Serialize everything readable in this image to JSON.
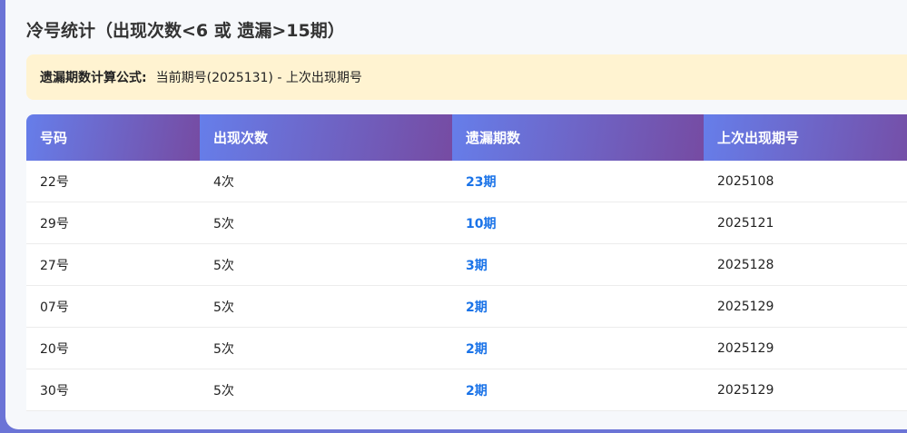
{
  "title": "冷号统计（出现次数<6 或 遗漏>15期）",
  "formula": {
    "label": "遗漏期数计算公式:",
    "text": "当前期号(2025131) - 上次出现期号"
  },
  "table": {
    "headers": [
      "号码",
      "出现次数",
      "遗漏期数",
      "上次出现期号"
    ],
    "rows": [
      [
        "22号",
        "4次",
        "23期",
        "2025108"
      ],
      [
        "29号",
        "5次",
        "10期",
        "2025121"
      ],
      [
        "27号",
        "5次",
        "3期",
        "2025128"
      ],
      [
        "07号",
        "5次",
        "2期",
        "2025129"
      ],
      [
        "20号",
        "5次",
        "2期",
        "2025129"
      ],
      [
        "30号",
        "5次",
        "2期",
        "2025129"
      ]
    ]
  },
  "colors": {
    "header_gradient_start": "#667eea",
    "header_gradient_end": "#764ba2",
    "miss_text": "#1a73e8",
    "formula_bg": "#fff3d1"
  }
}
